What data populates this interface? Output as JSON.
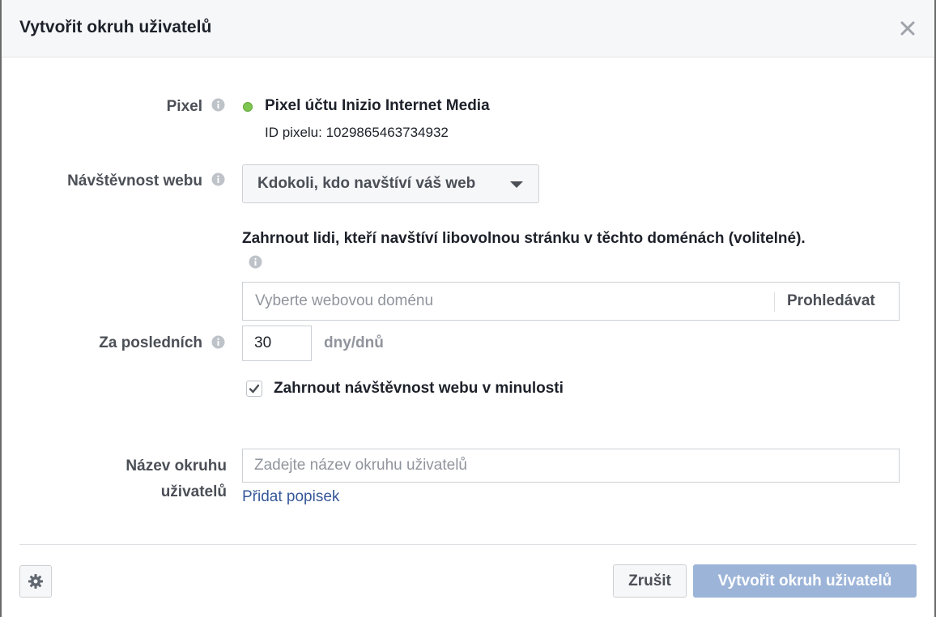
{
  "dialog": {
    "title": "Vytvořit okruh uživatelů"
  },
  "pixel": {
    "label": "Pixel",
    "name": "Pixel účtu Inizio Internet Media",
    "id_text": "ID pixelu: 1029865463734932",
    "status_color": "#7fc650"
  },
  "traffic": {
    "label": "Návštěvnost webu",
    "selected": "Kdokoli, kdo navštíví váš web"
  },
  "domains": {
    "heading": "Zahrnout lidi, kteří navštíví libovolnou stránku v těchto doménách (volitelné).",
    "placeholder": "Vyberte webovou doménu",
    "search_label": "Prohledávat"
  },
  "retention": {
    "label": "Za posledních",
    "value": "30",
    "unit": "dny/dnů"
  },
  "past_traffic": {
    "label": "Zahrnout návštěvnost webu v minulosti",
    "checked": true
  },
  "audience_name": {
    "label_line1": "Název okruhu",
    "label_line2": "uživatelů",
    "placeholder": "Zadejte název okruhu uživatelů",
    "add_description": "Přidat popisek"
  },
  "footer": {
    "cancel_label": "Zrušit",
    "create_label": "Vytvořit okruh uživatelů"
  },
  "colors": {
    "link": "#365899",
    "primary_disabled": "#9cb4d8"
  }
}
